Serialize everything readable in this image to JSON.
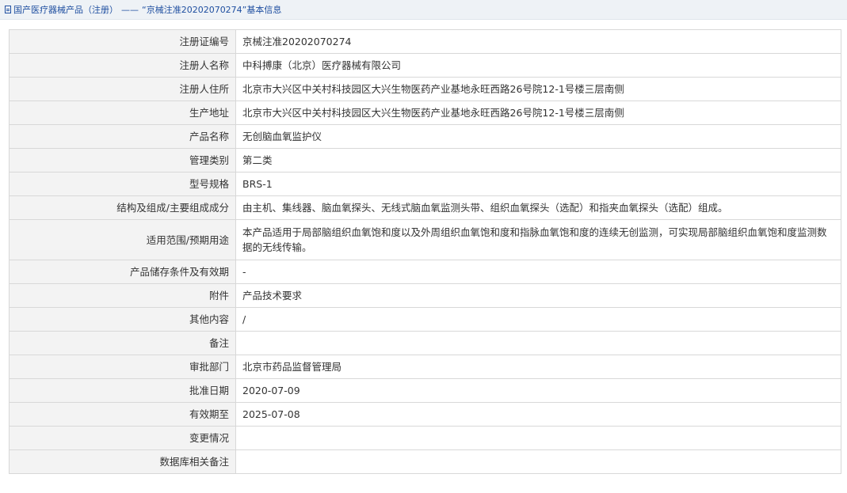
{
  "breadcrumb": {
    "icon": "document-icon",
    "category": "国产医疗器械产品（注册）",
    "separator": "——",
    "title": "“京械注准20202070274”基本信息"
  },
  "rows": [
    {
      "label": "注册证编号",
      "value": "京械注准20202070274"
    },
    {
      "label": "注册人名称",
      "value": "中科搏康（北京）医疗器械有限公司"
    },
    {
      "label": "注册人住所",
      "value": "北京市大兴区中关村科技园区大兴生物医药产业基地永旺西路26号院12-1号楼三层南侧"
    },
    {
      "label": "生产地址",
      "value": "北京市大兴区中关村科技园区大兴生物医药产业基地永旺西路26号院12-1号楼三层南侧"
    },
    {
      "label": "产品名称",
      "value": "无创脑血氧监护仪"
    },
    {
      "label": "管理类别",
      "value": "第二类"
    },
    {
      "label": "型号规格",
      "value": "BRS-1"
    },
    {
      "label": "结构及组成/主要组成成分",
      "value": "由主机、集线器、脑血氧探头、无线式脑血氧监测头带、组织血氧探头（选配）和指夹血氧探头（选配）组成。"
    },
    {
      "label": "适用范围/预期用途",
      "value": "本产品适用于局部脑组织血氧饱和度以及外周组织血氧饱和度和指脉血氧饱和度的连续无创监测，可实现局部脑组织血氧饱和度监测数据的无线传输。"
    },
    {
      "label": "产品储存条件及有效期",
      "value": "-"
    },
    {
      "label": "附件",
      "value": "产品技术要求"
    },
    {
      "label": "其他内容",
      "value": "/"
    },
    {
      "label": "备注",
      "value": ""
    },
    {
      "label": "审批部门",
      "value": "北京市药品监督管理局"
    },
    {
      "label": "批准日期",
      "value": "2020-07-09"
    },
    {
      "label": "有效期至",
      "value": "2025-07-08"
    },
    {
      "label": "变更情况",
      "value": ""
    },
    {
      "label": "数据库相关备注",
      "value": ""
    }
  ]
}
